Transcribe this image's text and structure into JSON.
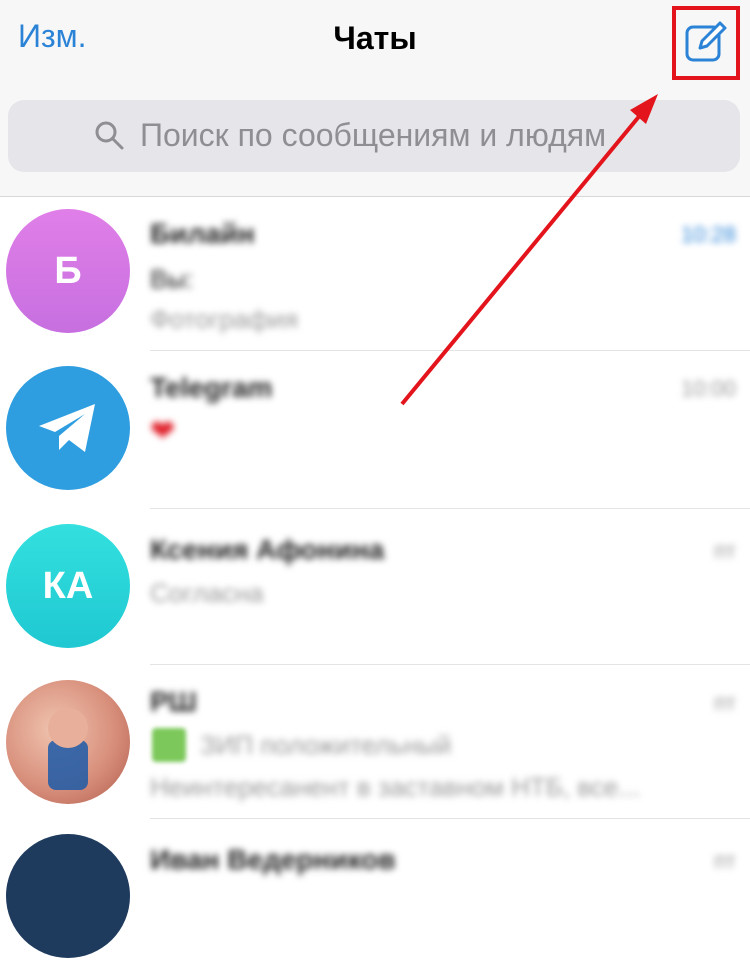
{
  "header": {
    "edit_label": "Изм.",
    "title": "Чаты"
  },
  "search": {
    "placeholder": "Поиск по сообщениям и людям"
  },
  "chats": [
    {
      "avatar_text": "Б",
      "name": "Билайн",
      "line1": "Вы:",
      "line2": "Фотография",
      "time": "10:28"
    },
    {
      "avatar_text": "",
      "name": "Telegram",
      "line1": "❤",
      "line2": "",
      "time": "10:00"
    },
    {
      "avatar_text": "КА",
      "name": "Ксения Афонина",
      "line1": "Согласна",
      "line2": "",
      "time": "пт"
    },
    {
      "avatar_text": "",
      "name": "РШ",
      "line1": "ЗИП положительный",
      "line2": "Неинтересанент в заставном НТБ, все...",
      "time": "пт"
    },
    {
      "avatar_text": "",
      "name": "Иван Ведерников",
      "line1": "",
      "line2": "",
      "time": "пт"
    }
  ],
  "colors": {
    "accent": "#2a83d6",
    "highlight": "#e3141c",
    "avatar_b": "#d27ae6",
    "avatar_tg": "#2f9ee0",
    "avatar_ka": "#2ad4d8"
  }
}
